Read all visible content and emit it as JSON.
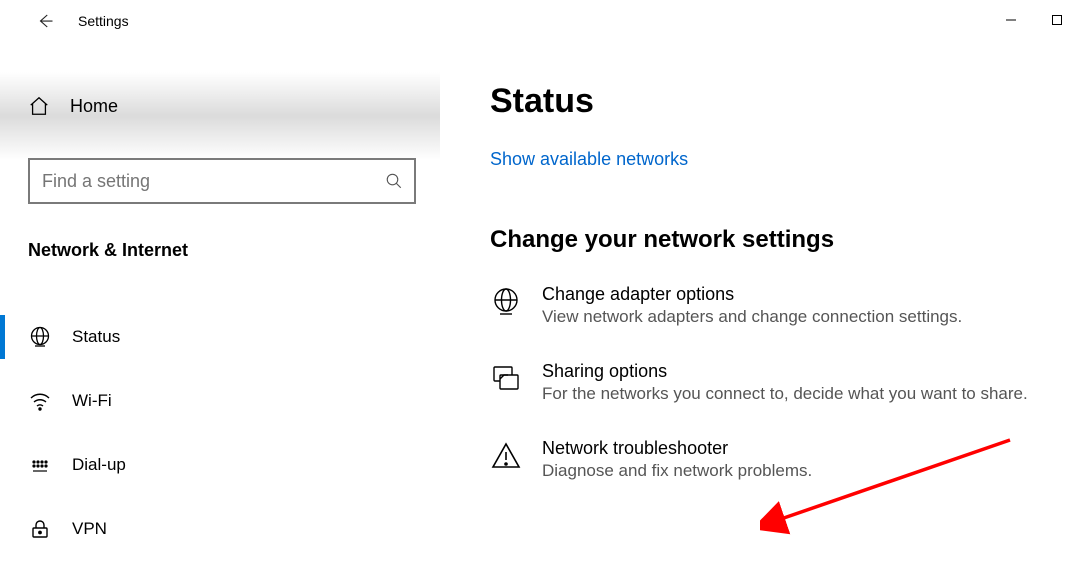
{
  "titlebar": {
    "title": "Settings"
  },
  "sidebar": {
    "home_label": "Home",
    "search_placeholder": "Find a setting",
    "category": "Network & Internet",
    "items": [
      {
        "label": "Status"
      },
      {
        "label": "Wi-Fi"
      },
      {
        "label": "Dial-up"
      },
      {
        "label": "VPN"
      }
    ]
  },
  "main": {
    "title": "Status",
    "link": "Show available networks",
    "section_title": "Change your network settings",
    "options": [
      {
        "title": "Change adapter options",
        "desc": "View network adapters and change connection settings."
      },
      {
        "title": "Sharing options",
        "desc": "For the networks you connect to, decide what you want to share."
      },
      {
        "title": "Network troubleshooter",
        "desc": "Diagnose and fix network problems."
      }
    ]
  }
}
